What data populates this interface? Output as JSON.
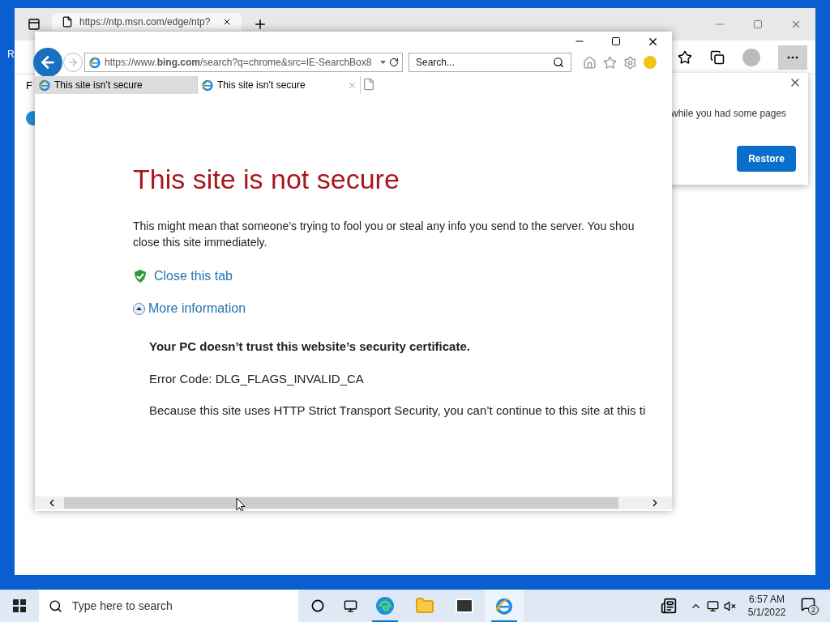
{
  "desktop": {
    "icon_labels": [
      "R"
    ]
  },
  "edge_window": {
    "tab": {
      "title": "https://ntp.msn.com/edge/ntp?"
    },
    "favorites_bar_text": "F",
    "popup": {
      "message": "while you had some pages",
      "button": "Restore"
    }
  },
  "ie_window": {
    "address": "https://www.**bing.com**/search?q=chrome&src=IE-SearchBox8",
    "search": {
      "placeholder": "Search..."
    },
    "tabs": [
      {
        "title": "This site isn’t secure",
        "selected": false
      },
      {
        "title": "This site isn’t secure",
        "selected": true
      }
    ],
    "page": {
      "heading": "This site is not secure",
      "lines": [
        "This might mean that someone’s trying to fool you or steal any info you send to the server. You shou",
        "close this site immediately."
      ],
      "close_link": "Close this tab",
      "more_link": "More information",
      "more_expanded": true,
      "details": [
        {
          "kind": "bold",
          "text": "Your PC doesn’t trust this website’s security certificate."
        },
        {
          "kind": "plain",
          "text": "Error Code: DLG_FLAGS_INVALID_CA"
        },
        {
          "kind": "plain",
          "text": "Because this site uses HTTP Strict Transport Security, you can’t continue to this site at this ti"
        }
      ]
    }
  },
  "taskbar": {
    "search_placeholder": "Type here to search",
    "apps": [
      {
        "kind": "edge",
        "running": true,
        "selected": false
      },
      {
        "kind": "explorer",
        "running": false,
        "selected": false
      },
      {
        "kind": "mail",
        "running": false,
        "selected": false
      },
      {
        "kind": "ie",
        "running": true,
        "selected": true
      }
    ],
    "time": "6:57 AM",
    "date": "5/1/2022",
    "notifications": "2"
  }
}
